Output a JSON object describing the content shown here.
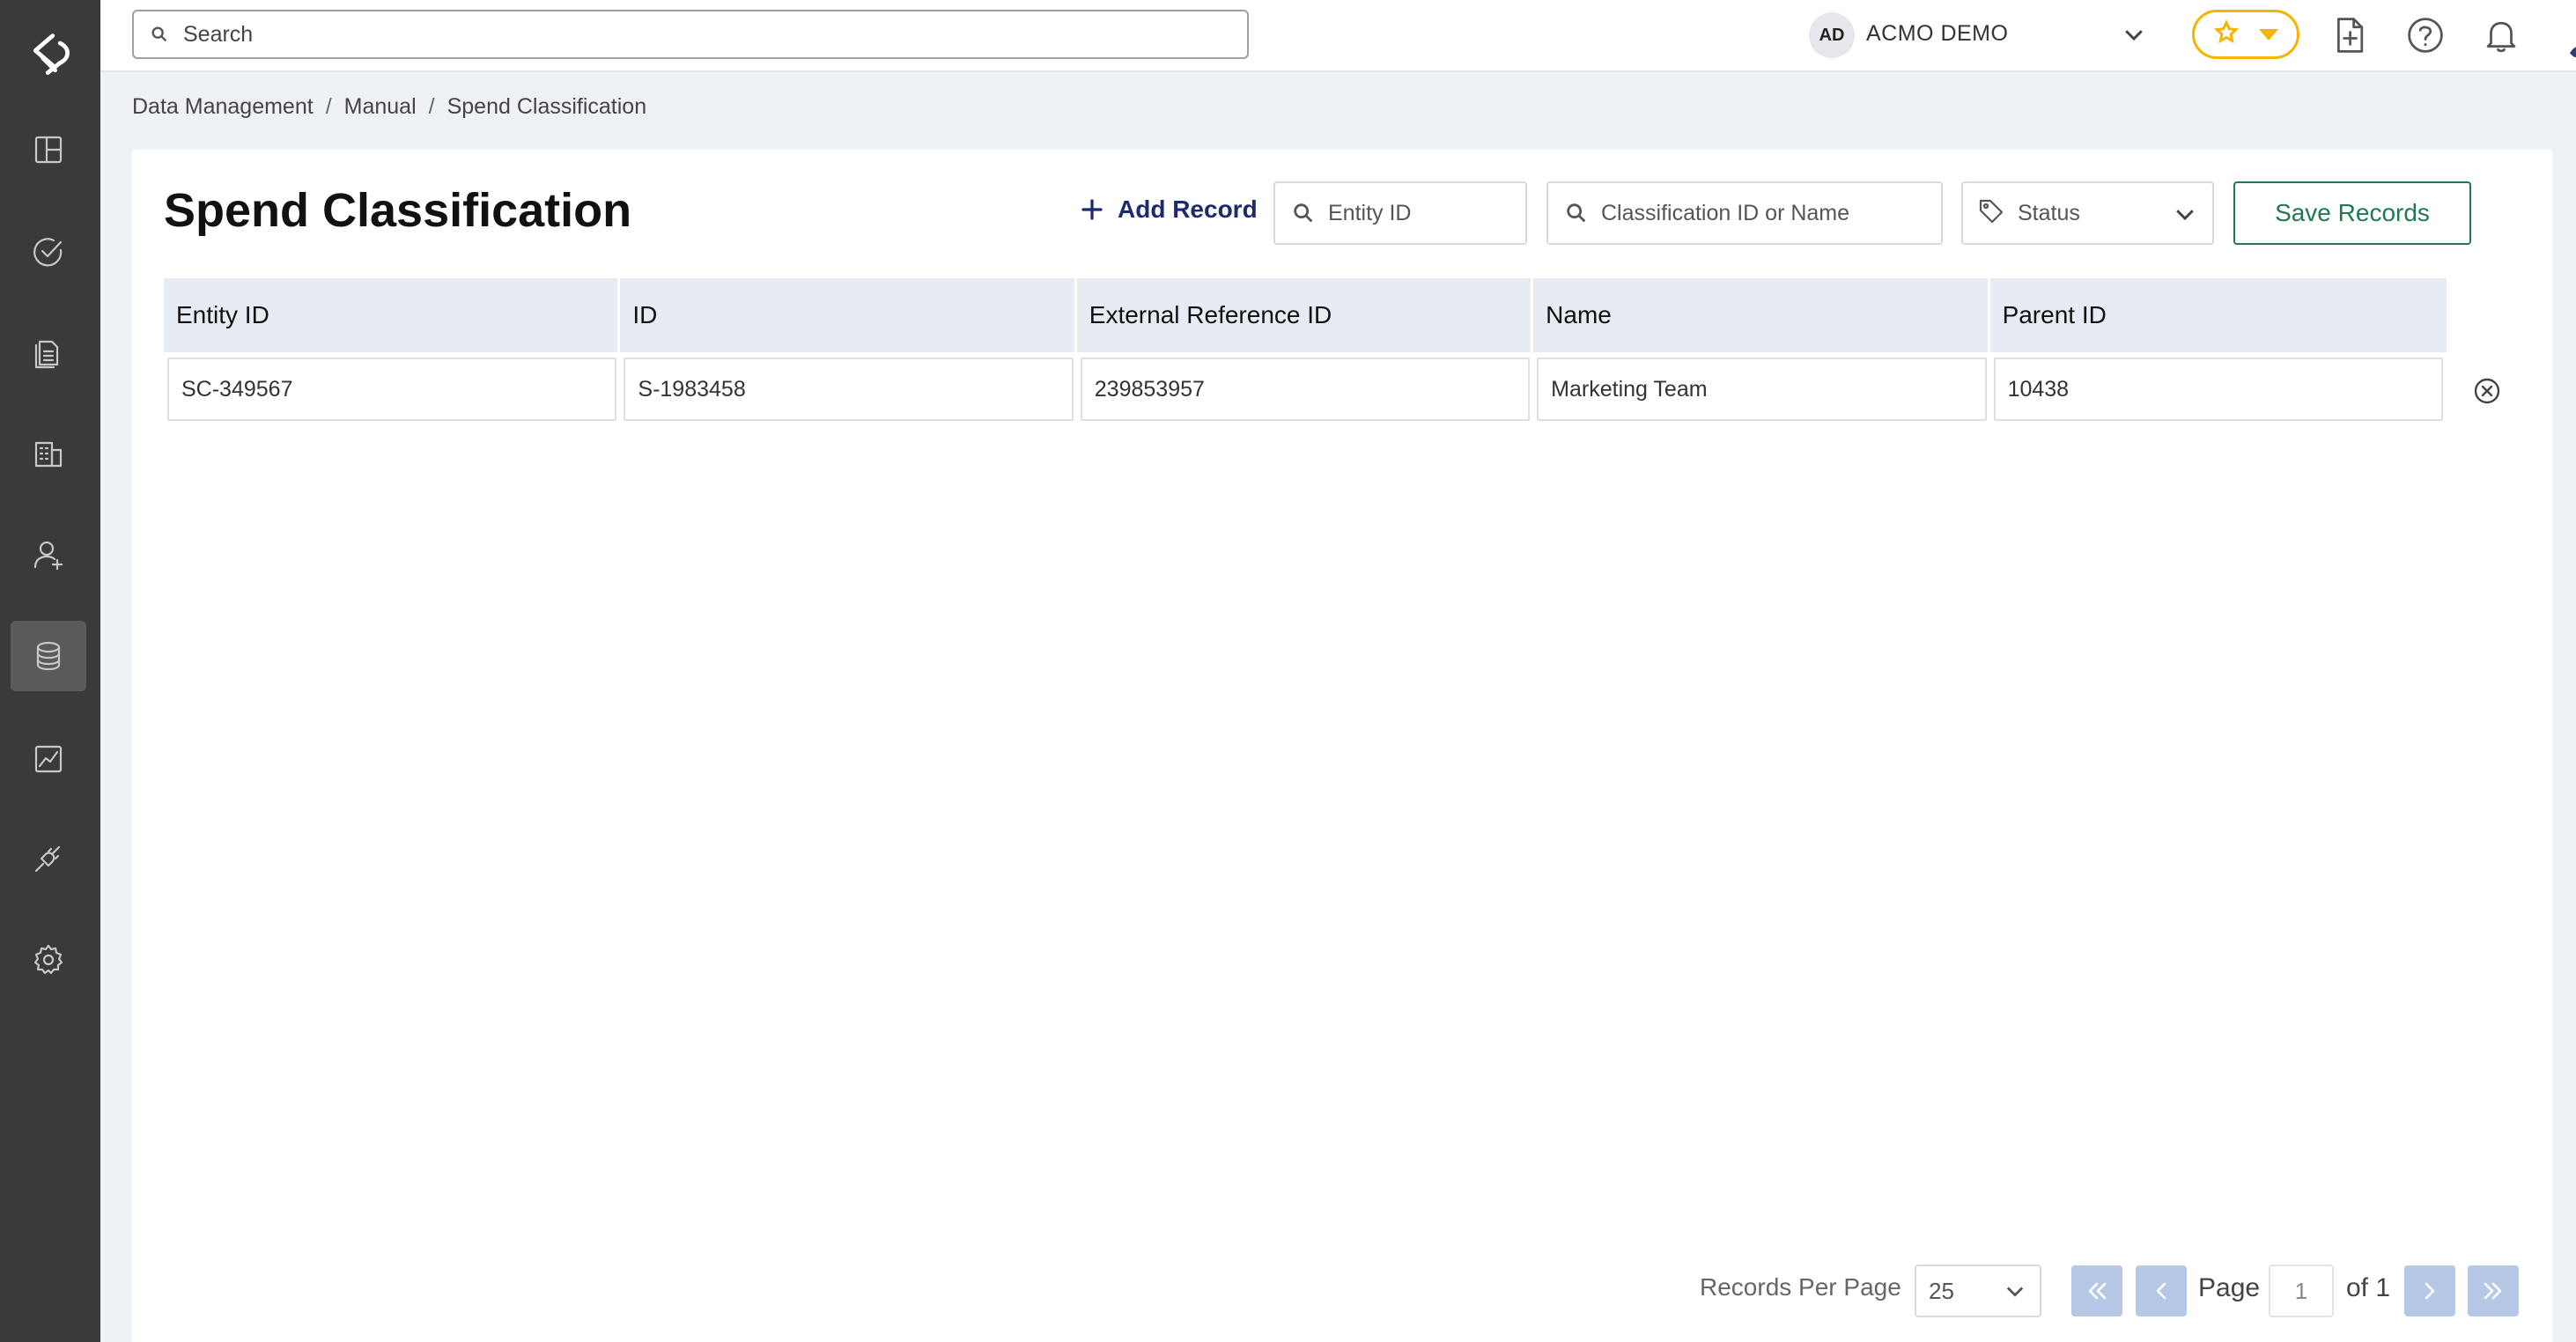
{
  "topbar": {
    "search_placeholder": "Search",
    "org_initials": "AD",
    "org_name": "ACMO DEMO"
  },
  "icons": {
    "sidebar": [
      "dashboard-icon",
      "tasks-icon",
      "documents-icon",
      "buildings-icon",
      "user-icon",
      "database-icon",
      "analytics-icon",
      "integrations-icon",
      "settings-icon"
    ],
    "topbar": [
      "search-icon",
      "star-icon",
      "new-document-icon",
      "help-icon",
      "bell-icon",
      "avatar",
      "chevron-down-icon"
    ]
  },
  "colors": {
    "sidebar_bg": "#3a3a3a",
    "accent_yellow": "#f5b400",
    "save_green": "#1f7a4f",
    "link_navy": "#1d2a6b",
    "pager_btn": "#b7c8e6"
  },
  "breadcrumb": {
    "items": [
      "Data Management",
      "Manual",
      "Spend Classification"
    ],
    "separator": "/"
  },
  "page": {
    "title": "Spend Classification",
    "add_record_label": "Add Record",
    "entity_filter_placeholder": "Entity ID",
    "classification_filter_placeholder": "Classification ID or Name",
    "status_label": "Status",
    "save_label": "Save Records"
  },
  "table": {
    "columns": [
      "Entity ID",
      "ID",
      "External Reference ID",
      "Name",
      "Parent ID"
    ],
    "rows": [
      [
        "SC-349567",
        "S-1983458",
        "239853957",
        "Marketing Team",
        "10438"
      ]
    ]
  },
  "pagination": {
    "records_per_page_label": "Records Per Page",
    "records_per_page": "25",
    "page_label": "Page",
    "current_page": "1",
    "of_label": "of 1"
  }
}
